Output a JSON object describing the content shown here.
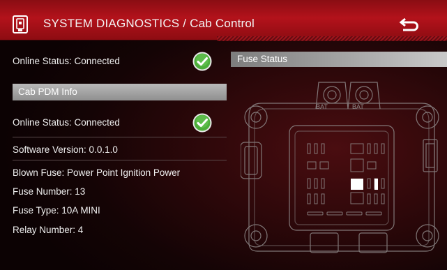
{
  "header": {
    "title": "SYSTEM DIAGNOSTICS / Cab Control",
    "app_icon": "pdm-module-icon",
    "back_icon": "return-arrow-icon"
  },
  "status": {
    "online_status": "Online Status: Connected",
    "status_icon": "green-check-icon"
  },
  "cab_pdm": {
    "section_title": "Cab PDM Info",
    "online_status": "Online Status: Connected",
    "software_version": "Software Version: 0.0.1.0",
    "blown_fuse": "Blown Fuse: Power Point Ignition Power",
    "fuse_number": "Fuse Number: 13",
    "fuse_type": "Fuse Type: 10A MINI",
    "relay_number": "Relay Number: 4"
  },
  "fuse_status": {
    "section_title": "Fuse Status",
    "bat_label_left": "BAT",
    "bat_label_right": "BAT",
    "highlight_color": "#ffffff"
  },
  "colors": {
    "header_red": "#b3121b",
    "ok_green": "#4cae3a"
  }
}
